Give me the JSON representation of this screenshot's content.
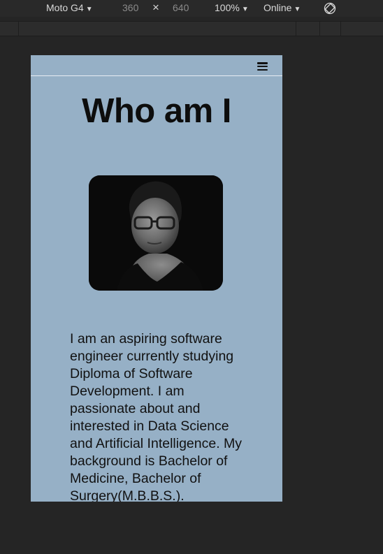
{
  "devtools": {
    "device": "Moto G4",
    "width": "360",
    "times": "×",
    "height": "640",
    "zoom": "100%",
    "network": "Online",
    "caret": "▼"
  },
  "page": {
    "heading": "Who am I",
    "bio": "I am an aspiring software engineer currently studying Diploma of Software Development. I am passionate about and interested in Data Science and Artificial Intelligence. My background is Bachelor of Medicine, Bachelor of Surgery(M.B.B.S.)."
  },
  "colors": {
    "page_background": "#96b0c6",
    "devtools_background": "#252525"
  }
}
